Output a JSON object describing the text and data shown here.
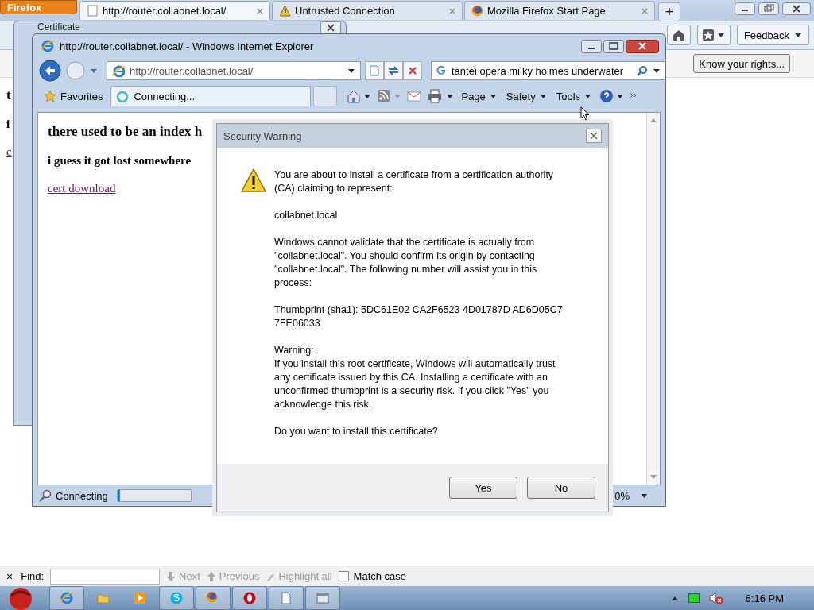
{
  "firefox": {
    "menu_button": "Firefox",
    "tabs": [
      {
        "label": "http://router.collabnet.local/",
        "kind": "blank",
        "selected": true
      },
      {
        "label": "Untrusted Connection",
        "kind": "warning",
        "selected": false
      },
      {
        "label": "Mozilla Firefox Start Page",
        "kind": "firefox",
        "selected": false
      }
    ],
    "new_tab": "+",
    "feedback_button": "Feedback",
    "notification_button": "Know your rights...",
    "page_fragments": [
      {
        "kind": "heading",
        "text": "t"
      },
      {
        "kind": "text",
        "text": "i"
      },
      {
        "kind": "link",
        "text": "c"
      }
    ],
    "find_bar": {
      "close": "×",
      "label": "Find:",
      "next": "Next",
      "previous": "Previous",
      "highlight_all": "Highlight all",
      "match_case": {
        "label": "Match case",
        "checked": false
      }
    }
  },
  "certificate_window": {
    "title": "Certificate"
  },
  "ie_window": {
    "title": "http://router.collabnet.local/ - Windows Internet Explorer",
    "address": "http://router.collabnet.local/",
    "search": "tantei opera milky holmes underwater",
    "favorites": "Favorites",
    "tab": "Connecting...",
    "menus": [
      "Page",
      "Safety",
      "Tools"
    ],
    "page": {
      "heading": "there used to be an index h",
      "subheading": "i guess it got lost somewhere",
      "link": "cert download"
    },
    "status": {
      "text": "Connecting",
      "level": 0.03,
      "zoom": "0%"
    }
  },
  "security_dialog": {
    "title": "Security Warning",
    "paragraphs": [
      {
        "kind": "para",
        "text": "You are about to install a certificate from a certification authority (CA) claiming to represent:"
      },
      {
        "kind": "para",
        "text": "collabnet.local"
      },
      {
        "kind": "para",
        "text": "Windows cannot validate that the certificate is actually from \"collabnet.local\". You should confirm its origin by contacting \"collabnet.local\". The following number will assist you in this process:"
      },
      {
        "kind": "para",
        "text": "Thumbprint (sha1): 5DC61E02 CA2F6523 4D01787D AD6D05C7 7FE06033"
      },
      {
        "kind": "label",
        "text": "Warning:"
      },
      {
        "kind": "para",
        "text": "If you install this root certificate, Windows will automatically trust any certificate issued by this CA. Installing a certificate with an unconfirmed thumbprint is a security risk. If you click \"Yes\" you acknowledge this risk."
      },
      {
        "kind": "para",
        "text": "Do you want to install this certificate?"
      }
    ],
    "buttons": [
      "Yes",
      "No"
    ]
  },
  "taskbar": {
    "apps": [
      {
        "kind": "ie",
        "selected": true
      },
      {
        "kind": "folder",
        "selected": false
      },
      {
        "kind": "media",
        "selected": false
      },
      {
        "kind": "skype",
        "selected": true
      },
      {
        "kind": "firefox",
        "selected": true
      },
      {
        "kind": "opera",
        "selected": true
      },
      {
        "kind": "document",
        "selected": true
      },
      {
        "kind": "window",
        "selected": true
      }
    ],
    "clock": "6:16 PM"
  }
}
